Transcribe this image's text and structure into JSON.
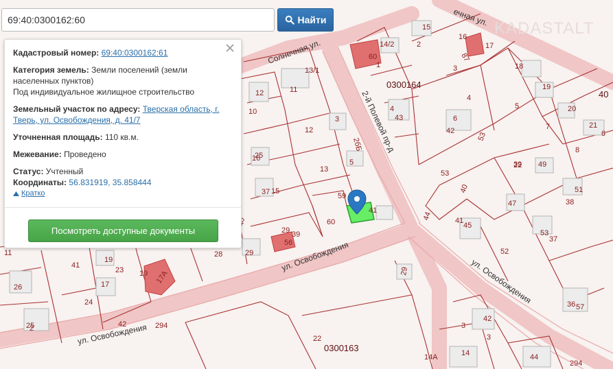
{
  "search": {
    "value": "69:40:0300162:60",
    "button_label": "Найти"
  },
  "info": {
    "cad_label": "Кадастровый номер:",
    "cad_value": "69:40:0300162:61",
    "cat_label": "Категория земель:",
    "cat_value": "Земли поселений (земли населенных пунктов)",
    "cat_use": "Под индивидуальное жилищное строительство",
    "addr_label": "Земельный участок по адресу:",
    "addr_value": "Тверская область, г. Тверь, ул. Освобождения, д. 41/7",
    "area_label": "Уточненная площадь:",
    "area_value": "110 кв.м.",
    "survey_label": "Межевание:",
    "survey_value": "Проведено",
    "status_label": "Статус:",
    "status_value": "Учтенный",
    "coords_label": "Координаты:",
    "coords_value": "56.831919, 35.858444",
    "short_label": "Кратко",
    "docs_button": "Посмотреть доступные документы"
  },
  "watermark": "KADASTALT",
  "map": {
    "quarters": [
      "0300164",
      "0300163",
      "40"
    ],
    "streets": [
      "Солнечная ул.",
      "2-й Полевой пр-д",
      "ул. Освобождения",
      "ул. Освобождения",
      "ул. Освобождения",
      "ечная ул."
    ],
    "labels": [
      "15",
      "14/2",
      "2",
      "16",
      "17",
      "87",
      "60",
      "1",
      "3",
      "18",
      "13/1",
      "11",
      "12",
      "10",
      "4",
      "43",
      "4",
      "19",
      "5",
      "20",
      "6",
      "42",
      "3",
      "12",
      "2бБ",
      "53",
      "7",
      "21",
      "8",
      "6",
      "22",
      "5",
      "16",
      "25",
      "13",
      "39",
      "49",
      "37",
      "15",
      "53",
      "40",
      "51",
      "38",
      "47",
      "59",
      "60",
      "41",
      "44",
      "41",
      "45",
      "53",
      "37",
      "29",
      "56",
      "39",
      "40",
      "28",
      "29",
      "52",
      "11",
      "19",
      "23",
      "41",
      "19",
      "17А",
      "17",
      "26",
      "24",
      "25",
      "42",
      "294",
      "29",
      "22",
      "3",
      "42",
      "3",
      "36",
      "57",
      "14",
      "44",
      "14А",
      "294",
      "2"
    ]
  },
  "colors": {
    "accent": "#2e6da4",
    "success": "#5cb85c",
    "parcel_selected": "#66ee66",
    "building": "#e06060",
    "boundary": "#a23a3a"
  }
}
